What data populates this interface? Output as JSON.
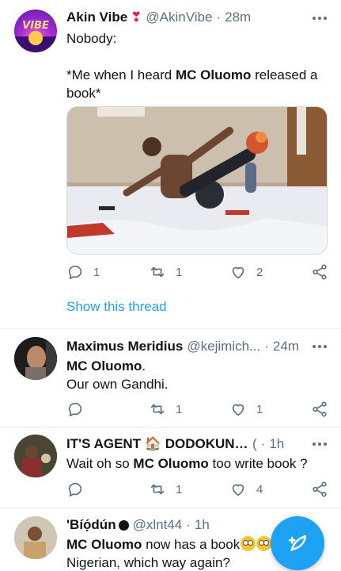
{
  "tweets": [
    {
      "name": "Akin Vibe",
      "badge": "❣",
      "handle": "@AkinVibe",
      "time": "28m",
      "avatar_text": "VIBE",
      "text_line1": "Nobody:",
      "text_pre": "*Me when I heard ",
      "text_bold": "MC Oluomo",
      "text_post": " released a book*",
      "reply_count": "1",
      "retweet_count": "1",
      "like_count": "2",
      "show_thread": "Show this thread"
    },
    {
      "name": "Maximus Meridius",
      "handle": "@kejimich...",
      "time": "24m",
      "text_bold": "MC Oluomo",
      "text_post": ".",
      "text_line2": "Our own Gandhi.",
      "retweet_count": "1",
      "like_count": "1"
    },
    {
      "name": "IT'S AGENT 🏠 DODOKUNLE 🕒",
      "handle": "(",
      "time": "1h",
      "text_pre": "Wait oh so ",
      "text_bold": "MC Oluomo",
      "text_post": " too write book ?",
      "retweet_count": "1",
      "like_count": "4"
    },
    {
      "name": "'Bíọ́dún",
      "handle": "@xlnt44",
      "time": "1h",
      "text_bold": "MC Oluomo",
      "text_post": " now has a book",
      "text_line2": "Nigerian, which way again?"
    }
  ],
  "colors": {
    "accent": "#1da1f2",
    "secondary_text": "#5b7083",
    "divider": "#e6ecf0",
    "badge": "#e0245e"
  },
  "icons": [
    "reply-icon",
    "retweet-icon",
    "like-icon",
    "share-icon",
    "more-icon",
    "compose-tweet-icon"
  ]
}
